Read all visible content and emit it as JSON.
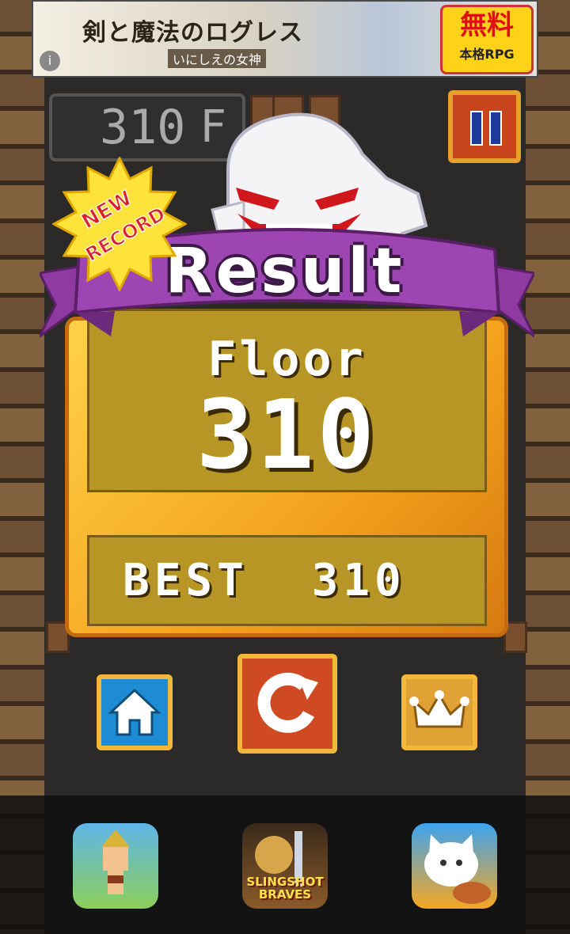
{
  "ad": {
    "title": "剣と魔法のログレス",
    "subtitle": "いにしえの女神",
    "badge_big": "無料",
    "badge_small": "本格RPG",
    "info": "i"
  },
  "hud": {
    "floor_value": "310",
    "floor_unit": "F"
  },
  "badge": {
    "line1": "NEW",
    "line2": "RECORD"
  },
  "result": {
    "title": "Result",
    "floor_label": "Floor",
    "floor_value": "310",
    "best_label": "BEST",
    "best_value": "310"
  },
  "buttons": {
    "home_icon": "home-icon",
    "retry_icon": "retry-icon",
    "ranking_icon": "crown-icon"
  },
  "apps": [
    {
      "icon": "pixel-hero-app-icon"
    },
    {
      "icon": "slingshot-braves-app-icon",
      "caption_line1": "SLINGSHOT",
      "caption_line2": "BRAVES"
    },
    {
      "icon": "cat-app-icon"
    }
  ],
  "colors": {
    "ribbon": "#8e3aa0",
    "panel": "#f3a21c",
    "button_border": "#f3b73a",
    "home": "#1e8cd4",
    "retry": "#cf4a22",
    "rank": "#e0a235",
    "badge_red": "#d8232a",
    "badge_yellow": "#ffe23a"
  }
}
